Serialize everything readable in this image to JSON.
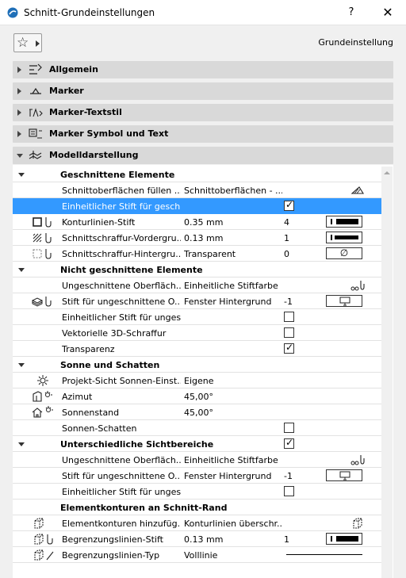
{
  "window": {
    "title": "Schnitt-Grundeinstellungen",
    "help": "?",
    "close": "✕"
  },
  "preset": {
    "label": "Grundeinstellung"
  },
  "sections": {
    "allgemein": "Allgemein",
    "marker": "Marker",
    "marker_textstil": "Marker-Textstil",
    "marker_symbol": "Marker Symbol und Text",
    "modelldarstellung": "Modelldarstellung"
  },
  "groups": {
    "geschnittene": "Geschnittene Elemente",
    "nicht_geschnittene": "Nicht geschnittene Elemente",
    "sonne": "Sonne und Schatten",
    "sichtbereiche": "Unterschiedliche Sichtbereiche",
    "konturen": "Elementkonturen an Schnitt-Rand"
  },
  "rows": {
    "r1": {
      "name": "Schnittoberflächen füllen ...",
      "value": "Schnittoberflächen - ..."
    },
    "r2": {
      "name": "Einheitlicher Stift für gesch...",
      "checked": true
    },
    "r3": {
      "name": "Konturlinien-Stift",
      "value": "0.35 mm",
      "pen": "4"
    },
    "r4": {
      "name": "Schnittschraffur-Vordergru...",
      "value": "0.13 mm",
      "pen": "1"
    },
    "r5": {
      "name": "Schnittschraffur-Hintergru...",
      "value": "Transparent",
      "pen": "0",
      "pen_symbol": "∅"
    },
    "r6": {
      "name": "Ungeschnittene Oberfläch...",
      "value": "Einheitliche Stiftfarbe"
    },
    "r7": {
      "name": "Stift für ungeschnittene O...",
      "value": "Fenster Hintergrund",
      "pen": "-1"
    },
    "r8": {
      "name": "Einheitlicher Stift für unges...",
      "checked": false
    },
    "r9": {
      "name": "Vektorielle 3D-Schraffur",
      "checked": false
    },
    "r10": {
      "name": "Transparenz",
      "checked": true
    },
    "r11": {
      "name": "Projekt-Sicht Sonnen-Einst...",
      "value": "Eigene"
    },
    "r12": {
      "name": "Azimut",
      "value": "45,00°"
    },
    "r13": {
      "name": "Sonnenstand",
      "value": "45,00°"
    },
    "r14": {
      "name": "Sonnen-Schatten",
      "checked": false
    },
    "r15": {
      "name": "Ungeschnittene Oberfläch...",
      "value": "Einheitliche Stiftfarbe"
    },
    "r16": {
      "name": "Stift für ungeschnittene O...",
      "value": "Fenster Hintergrund",
      "pen": "-1"
    },
    "r17": {
      "name": "Einheitlicher Stift für unges...",
      "checked": false
    },
    "r18": {
      "name": "Elementkonturen hinzufüg...",
      "value": "Konturlinien überschr..."
    },
    "r19": {
      "name": "Begrenzungslinien-Stift",
      "value": "0.13 mm",
      "pen": "1"
    },
    "r20": {
      "name": "Begrenzungslinien-Typ",
      "value": "Volllinie"
    }
  },
  "check_glyph": "✓",
  "colors": {
    "selection": "#3399ff",
    "section_bg": "#d9d9d9"
  }
}
